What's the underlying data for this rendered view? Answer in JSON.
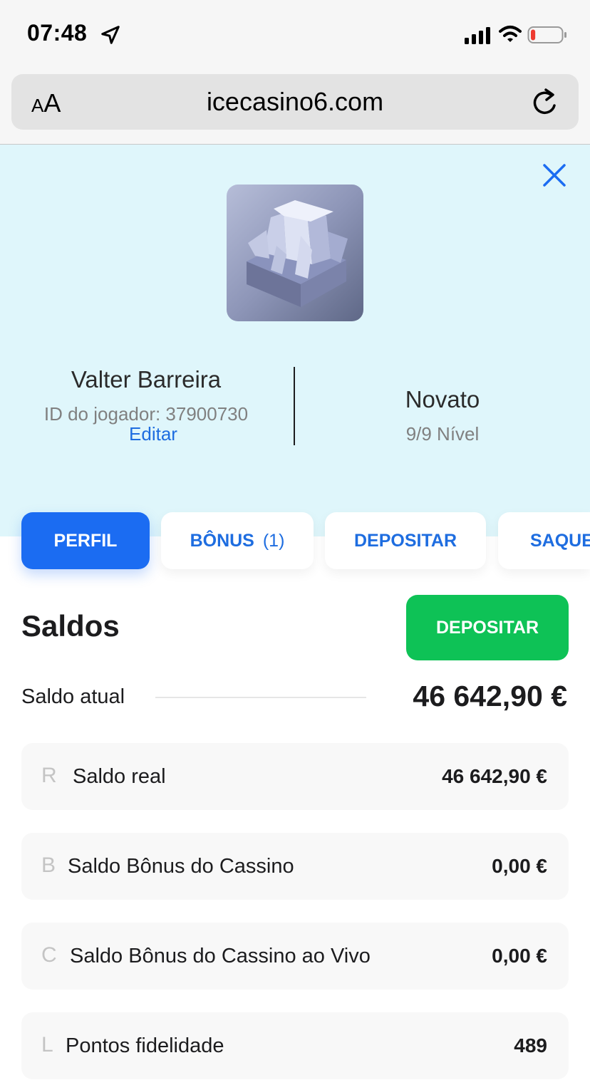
{
  "status_bar": {
    "time": "07:48",
    "location_icon": "location-arrow-icon",
    "signal_icon": "cellular-signal-icon",
    "wifi_icon": "wifi-icon",
    "battery_icon": "battery-low-icon",
    "battery_level_fraction": 0.15
  },
  "browser": {
    "text_size_label_small": "A",
    "text_size_label_large": "A",
    "url": "icecasino6.com",
    "reload_icon": "reload-icon"
  },
  "profile": {
    "close_icon": "close-icon",
    "avatar_icon": "ice-rock-avatar-icon",
    "name": "Valter Barreira",
    "player_id": "ID do jogador: 37900730",
    "edit_label": "Editar",
    "rank": "Novato",
    "level": "9/9 Nível"
  },
  "tabs": [
    {
      "label": "PERFIL",
      "active": true
    },
    {
      "label": "BÔNUS",
      "count": "(1)",
      "active": false
    },
    {
      "label": "DEPOSITAR",
      "active": false
    },
    {
      "label": "SAQUE",
      "active": false
    }
  ],
  "balances": {
    "title": "Saldos",
    "deposit_button": "DEPOSITAR",
    "current_label": "Saldo atual",
    "current_value": "46 642,90 €",
    "rows": [
      {
        "letter": "R",
        "label": "Saldo real",
        "value": "46 642,90 €"
      },
      {
        "letter": "B",
        "label": "Saldo Bônus do Cassino",
        "value": "0,00 €"
      },
      {
        "letter": "C",
        "label": "Saldo Bônus do Cassino ao Vivo",
        "value": "0,00 €"
      },
      {
        "letter": "L",
        "label": "Pontos fidelidade",
        "value": "489"
      }
    ]
  },
  "colors": {
    "accent_blue": "#1b6cf2",
    "link_blue": "#1e6de0",
    "deposit_green": "#0ec256",
    "hero_bg": "#dff6fb",
    "battery_red": "#ee3b30"
  }
}
